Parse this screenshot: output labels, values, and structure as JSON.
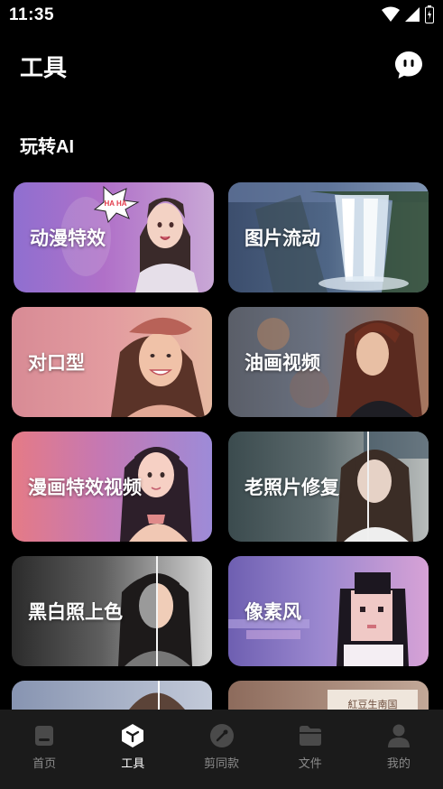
{
  "status_bar": {
    "time": "11:35"
  },
  "header": {
    "title": "工具",
    "chat_icon": "chat-bubble-icon"
  },
  "section": {
    "title": "玩转AI"
  },
  "tools": [
    {
      "label": "动漫特效"
    },
    {
      "label": "图片流动"
    },
    {
      "label": "对口型"
    },
    {
      "label": "油画视频"
    },
    {
      "label": "漫画特效视频"
    },
    {
      "label": "老照片修复"
    },
    {
      "label": "黑白照上色"
    },
    {
      "label": "像素风"
    }
  ],
  "anime_card_sticker": "HA HA",
  "partial_card_text": "紅豆生南国",
  "tabbar": {
    "items": [
      {
        "label": "首页",
        "icon": "home-icon",
        "active": false
      },
      {
        "label": "工具",
        "icon": "tool-cube-icon",
        "active": true
      },
      {
        "label": "剪同款",
        "icon": "cut-template-icon",
        "active": false
      },
      {
        "label": "文件",
        "icon": "folder-icon",
        "active": false
      },
      {
        "label": "我的",
        "icon": "profile-icon",
        "active": false
      }
    ]
  },
  "colors": {
    "background": "#000000",
    "tabbar": "#1b1b1b",
    "tab_inactive": "#8a8a8a",
    "tab_active": "#ffffff"
  }
}
